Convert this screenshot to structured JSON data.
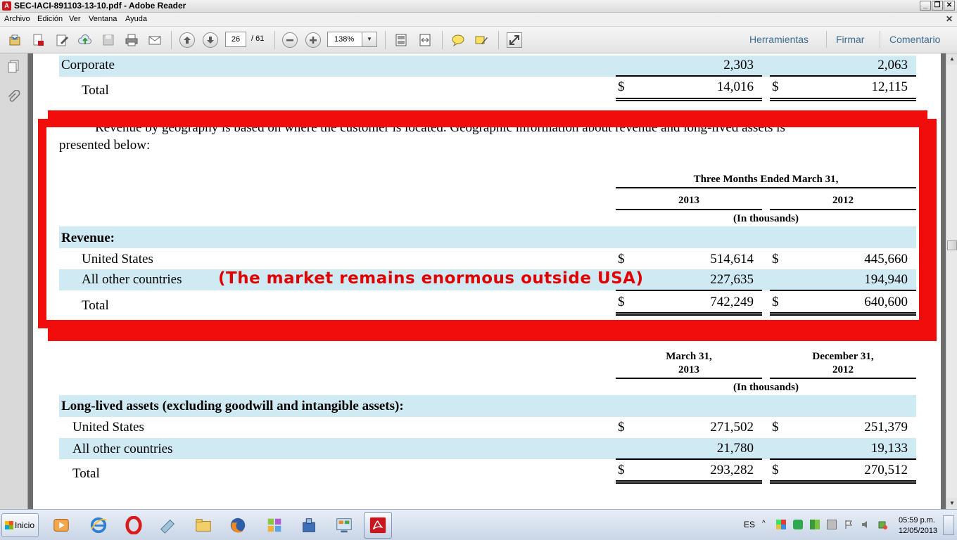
{
  "window": {
    "title": "SEC-IACI-891103-13-10.pdf - Adobe Reader",
    "icon": "adobe-reader-icon"
  },
  "menu": {
    "items": [
      "Archivo",
      "Edición",
      "Ver",
      "Ventana",
      "Ayuda"
    ],
    "close_glyph": "✕"
  },
  "toolbar": {
    "page_current": "26",
    "page_total": "/ 61",
    "zoom": "138%",
    "right_links": [
      "Herramientas",
      "Firmar",
      "Comentario"
    ]
  },
  "document": {
    "top_table": {
      "rows": [
        {
          "label": "Corporate",
          "col1_dollar": "",
          "col1": "2,303",
          "col2_dollar": "",
          "col2": "2,063"
        },
        {
          "label": "Total",
          "col1_dollar": "$",
          "col1": "14,016",
          "col2_dollar": "$",
          "col2": "12,115"
        }
      ]
    },
    "paragraph": {
      "line1": "Revenue by geography is based on where the customer is located. Geographic information about revenue and long-lived assets is",
      "line2": "presented below:"
    },
    "revenue_table": {
      "period_header": "Three Months Ended March 31,",
      "col1_year": "2013",
      "col2_year": "2012",
      "units": "(In thousands)",
      "section": "Revenue:",
      "rows": [
        {
          "label": "United States",
          "col1_dollar": "$",
          "col1": "514,614",
          "col2_dollar": "$",
          "col2": "445,660"
        },
        {
          "label": "All other countries",
          "col1_dollar": "",
          "col1": "227,635",
          "col2_dollar": "",
          "col2": "194,940"
        },
        {
          "label": "Total",
          "col1_dollar": "$",
          "col1": "742,249",
          "col2_dollar": "$",
          "col2": "640,600"
        }
      ]
    },
    "annotation": "(The market remains enormous outside USA)",
    "assets_table": {
      "col1_header_l1": "March 31,",
      "col1_header_l2": "2013",
      "col2_header_l1": "December 31,",
      "col2_header_l2": "2012",
      "units": "(In thousands)",
      "section": "Long-lived assets (excluding goodwill and intangible assets):",
      "rows": [
        {
          "label": "United States",
          "col1_dollar": "$",
          "col1": "271,502",
          "col2_dollar": "$",
          "col2": "251,379"
        },
        {
          "label": "All other countries",
          "col1_dollar": "",
          "col1": "21,780",
          "col2_dollar": "",
          "col2": "19,133"
        },
        {
          "label": "Total",
          "col1_dollar": "$",
          "col1": "293,282",
          "col2_dollar": "$",
          "col2": "270,512"
        }
      ]
    }
  },
  "colors": {
    "highlight_red": "#f20d0d",
    "row_band": "#d0eaf4",
    "link_blue": "#3a6a8e"
  },
  "taskbar": {
    "start_label": "Inicio",
    "language": "ES",
    "time": "05:59 p.m.",
    "date": "12/05/2013"
  }
}
